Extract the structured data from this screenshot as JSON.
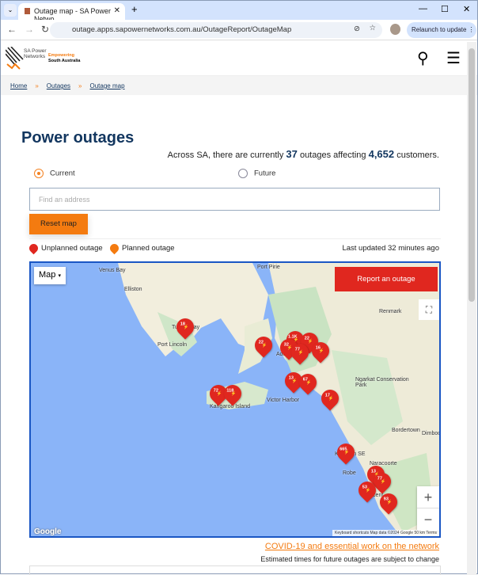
{
  "browser": {
    "tab_title": "Outage map - SA Power Netwo",
    "url": "outage.apps.sapowernetworks.com.au/OutageReport/OutageMap",
    "relaunch": "Relaunch to update"
  },
  "header": {
    "logo_text": "SA Power Networks",
    "tagline_1": "Empowering",
    "tagline_2": "South Australia"
  },
  "breadcrumb": [
    "Home",
    "Outages",
    "Outage map"
  ],
  "page": {
    "title": "Power outages",
    "summary_pre": "Across SA, there are currently ",
    "outage_count": "37",
    "summary_mid": " outages affecting ",
    "customer_count": "4,652",
    "summary_post": " customers."
  },
  "filters": {
    "current": "Current",
    "future": "Future",
    "selected": "Current"
  },
  "search": {
    "placeholder": "Find an address",
    "value": ""
  },
  "reset_label": "Reset map",
  "legend": {
    "unplanned": "Unplanned outage",
    "planned": "Planned outage",
    "unplanned_color": "#e0271f",
    "planned_color": "#f47b10"
  },
  "last_updated": "Last updated 32 minutes ago",
  "map": {
    "type_label": "Map",
    "report_label": "Report an outage",
    "zoom_in": "+",
    "zoom_out": "−",
    "places": [
      "Venus Bay",
      "Elliston",
      "Tumby Bay",
      "Port Lincoln",
      "Port Pirie",
      "Adelaide",
      "Victor Harbor",
      "Kangaroo Island",
      "Renmark",
      "Ngarkat Conservation Park",
      "Bordertown",
      "Naracoorte",
      "Kingston SE",
      "Robe",
      "Millicent",
      "Dimboola"
    ],
    "markers": [
      "18",
      "22",
      "1.1K",
      "32",
      "22",
      "77",
      "16",
      "13",
      "67",
      "17",
      "72",
      "118",
      "665",
      "13",
      "77",
      "53",
      "93"
    ],
    "google": "Google",
    "attribution": "Keyboard shortcuts   Map data ©2024 Google   50 km   Terms"
  },
  "footer": {
    "covid_link": "COVID-19 and essential work on the network",
    "note": "Estimated times for future outages are subject to change"
  }
}
